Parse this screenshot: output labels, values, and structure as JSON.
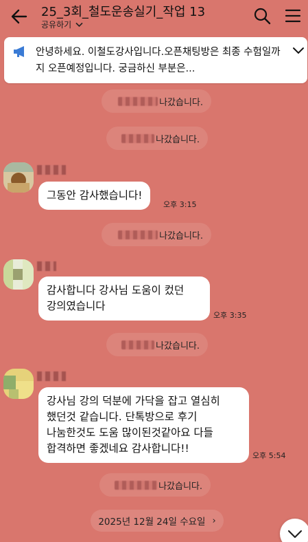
{
  "header": {
    "title": "25_3회_철도운송실기_작업 13",
    "share_label": "공유하기"
  },
  "notice": {
    "text": "안녕하세요. 이철도강사입니다.오픈채팅방은 최종 수험일까지 오픈예정입니다. 궁금하신 부분은..."
  },
  "system_messages": [
    {
      "text": "나갔습니다."
    },
    {
      "text": "나갔습니다."
    },
    {
      "text": "나갔습니다."
    },
    {
      "text": "나갔습니다."
    },
    {
      "text": "나갔습니다."
    }
  ],
  "messages": [
    {
      "text": "그동안 감사했습니다!",
      "time": "오후 3:15"
    },
    {
      "text": "감사합니다 강사님 도움이 컸던\n강의였습니다",
      "time": "오후 3:35"
    },
    {
      "text": "강사님 강의 덕분에 가닥을 잡고 열심히\n했던것 같습니다. 단톡방으로 후기\n나눔한것도 도움 많이된것같아요 다들\n합격하면 좋겠네요 감사합니다!!",
      "time": "오후 5:54"
    }
  ],
  "date_divider": {
    "label": "2025년 12월 24일 수요일",
    "chevron": "›"
  },
  "colors": {
    "background": "#d9766d",
    "bubble": "#ffffff",
    "notice_icon": "#3a7bd5"
  },
  "icons": [
    "back-arrow-icon",
    "search-icon",
    "menu-icon",
    "megaphone-icon",
    "chevron-down-icon"
  ]
}
